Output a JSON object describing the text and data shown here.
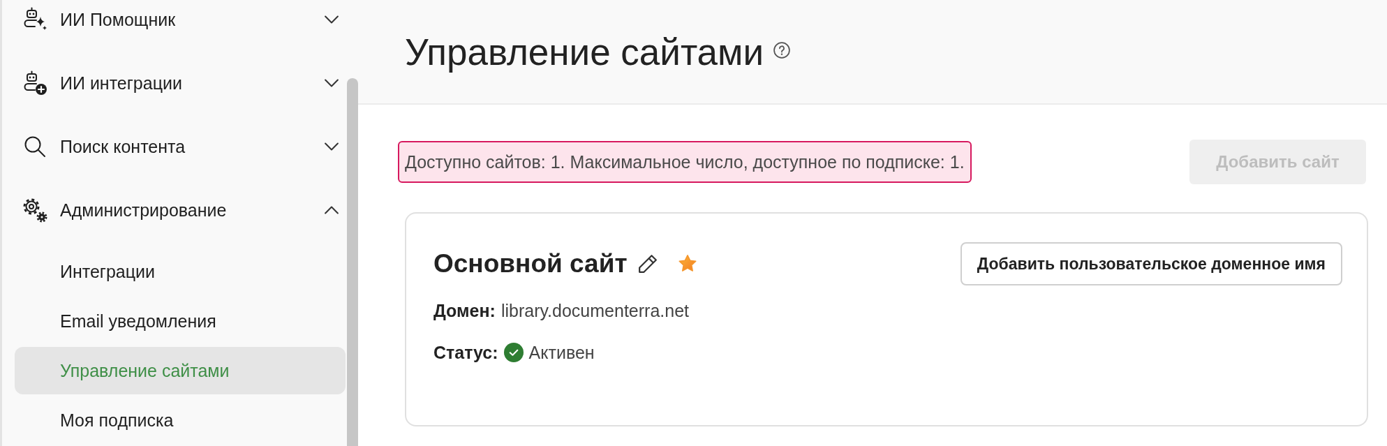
{
  "sidebar": {
    "items": [
      {
        "label": "ИИ Помощник",
        "expanded": false
      },
      {
        "label": "ИИ интеграции",
        "expanded": false
      },
      {
        "label": "Поиск контента",
        "expanded": false
      },
      {
        "label": "Администрирование",
        "expanded": true,
        "children": [
          {
            "label": "Интеграции",
            "selected": false
          },
          {
            "label": "Email уведомления",
            "selected": false
          },
          {
            "label": "Управление сайтами",
            "selected": true
          },
          {
            "label": "Моя подписка",
            "selected": false
          }
        ]
      }
    ]
  },
  "page": {
    "title": "Управление сайтами"
  },
  "notice": {
    "text": "Доступно сайтов: 1. Максимальное число, доступное по подписке: 1."
  },
  "add_site_button": {
    "label": "Добавить сайт",
    "disabled": true
  },
  "site_card": {
    "name": "Основной сайт",
    "favorite": true,
    "custom_domain_button": "Добавить пользовательское доменное имя",
    "fields": [
      {
        "kind": "text",
        "label": "Домен:",
        "value": "library.documenterra.net"
      },
      {
        "kind": "status",
        "label": "Статус:",
        "value": "Активен"
      }
    ]
  }
}
